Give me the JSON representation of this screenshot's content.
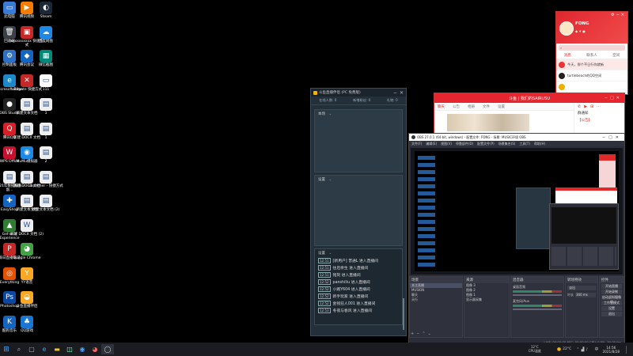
{
  "desktop": {
    "icons_col1": [
      {
        "label": "此电脑",
        "color": "#3a7bd5",
        "glyph": "▭"
      },
      {
        "label": "回收站",
        "color": "#3b3f47",
        "glyph": "🗑"
      },
      {
        "label": "控制面板",
        "color": "#2f6fc4",
        "glyph": "⚙"
      },
      {
        "label": "Microsoft Edge",
        "color": "#1e88c8",
        "glyph": "e"
      },
      {
        "label": "OBS Studio",
        "color": "#222",
        "glyph": "●"
      },
      {
        "label": "腾讯QQ",
        "color": "#d61f26",
        "glyph": "Q"
      },
      {
        "label": "WPS Office",
        "color": "#c8102e",
        "glyph": "W"
      },
      {
        "label": "2021年数据报表 - 副...",
        "color": "#eee",
        "glyph": "▤"
      },
      {
        "label": "EasyShop",
        "color": "#1565c0",
        "glyph": "✚"
      },
      {
        "label": "GeForce Experience",
        "color": "#2e7d32",
        "glyph": "▲"
      },
      {
        "label": "每日直播笔记",
        "color": "#c62828",
        "glyph": "P"
      },
      {
        "label": "Everything",
        "color": "#e65100",
        "glyph": "◎"
      },
      {
        "label": "Photoshop",
        "color": "#0d47a1",
        "glyph": "Ps"
      },
      {
        "label": "酷狗音乐",
        "color": "#1565c0",
        "glyph": "K"
      }
    ],
    "icons_col2": [
      {
        "label": "腾讯视频",
        "color": "#f57c00",
        "glyph": "▶"
      },
      {
        "label": "xxxxxxxxxx 快速方式",
        "color": "#c62828",
        "glyph": "▣"
      },
      {
        "label": "腾讯会议",
        "color": "#1565c0",
        "glyph": "◆"
      },
      {
        "label": "ultimate 快捷方式",
        "color": "#c62828",
        "glyph": "✕"
      },
      {
        "label": "新建文本文档",
        "color": "#eee",
        "glyph": "▤"
      },
      {
        "label": "新建 DOCX 文档",
        "color": "#eee",
        "glyph": "▤"
      },
      {
        "label": "MuMu模拟器",
        "color": "#1e88e5",
        "glyph": "◉"
      },
      {
        "label": "新建 DOCX 文档",
        "color": "#eee",
        "glyph": "▤"
      },
      {
        "label": "新建文本文档",
        "color": "#eee",
        "glyph": "▤"
      },
      {
        "label": "新建 DOCX 文档 (2)",
        "color": "#eee",
        "glyph": "W"
      },
      {
        "label": "Google Chrome",
        "color": "#43a047",
        "glyph": "◕"
      },
      {
        "label": "YY语音",
        "color": "#f9a825",
        "glyph": "Y"
      },
      {
        "label": "斗鱼直播伴侣",
        "color": "#f9a825",
        "glyph": "◒"
      },
      {
        "label": "QQ游戏",
        "color": "#1976d2",
        "glyph": "♣"
      }
    ],
    "icons_col3": [
      {
        "label": "Steam",
        "color": "#1b2838",
        "glyph": "◐"
      },
      {
        "label": "百度网盘",
        "color": "#1e88e5",
        "glyph": "☁"
      },
      {
        "label": "微信截图",
        "color": "#00897b",
        "glyph": "▦"
      },
      {
        "label": "111",
        "color": "#fff",
        "glyph": "▭"
      },
      {
        "label": "1",
        "color": "#eee",
        "glyph": "▤"
      },
      {
        "label": "1",
        "color": "#eee",
        "glyph": "▤"
      },
      {
        "label": "2",
        "color": "#eee",
        "glyph": "▤"
      },
      {
        "label": "Launcher - 快捷方式",
        "color": "#eee",
        "glyph": "▤"
      },
      {
        "label": "新建文本文档 (2)",
        "color": "#eee",
        "glyph": "▤"
      }
    ]
  },
  "danmu": {
    "title": "斗鱼直播伴侣 (PC 免费版)",
    "stats": [
      "在线人数: 0",
      "新增粉丝: 0",
      "礼物: 0"
    ],
    "panel1_label": "本场",
    "panel2_label": "设置",
    "panel3_label": "设置",
    "messages": [
      {
        "time": "12:51",
        "text": "[新用户] 普通L 进入直播间"
      },
      {
        "time": "12:51",
        "text": "往后余生 进入直播间"
      },
      {
        "time": "12:51",
        "text": "铭刻 进入直播间"
      },
      {
        "time": "12:52",
        "text": "panshiliu 进入直播间"
      },
      {
        "time": "12:52",
        "text": "小路Y604 进入直播间"
      },
      {
        "time": "12:52",
        "text": "新手玩家 进入直播间"
      },
      {
        "time": "12:52",
        "text": "金钱狂人001 进入直播间"
      },
      {
        "time": "12:53",
        "text": "冬夜与春风 进入直播间"
      }
    ]
  },
  "qq": {
    "name": "FONG",
    "tabs": [
      "消息",
      "联系人",
      "空间"
    ],
    "chats": [
      {
        "name": "今天，那个不日行你就新",
        "preview": ""
      },
      {
        "name": "turtlebeach的QQ空间",
        "preview": ""
      },
      {
        "name": "",
        "preview": ""
      }
    ]
  },
  "chat_window": {
    "title": "斗鱼 | 我们的SAIRUSU",
    "tabs": [
      "聊天",
      "公告",
      "相册",
      "文件",
      "设置"
    ],
    "side_name": "群通知",
    "side_msg": "【公告】"
  },
  "obs": {
    "title": "OBS 27.0.1 (64-bit, windows) - 配置文件: FONG - 场景: MUSIC环境 OBS",
    "menu": [
      "文件(F)",
      "编辑(E)",
      "视图(V)",
      "停靠部件(D)",
      "配置文件(P)",
      "场景集合(S)",
      "工具(T)",
      "帮助(H)"
    ],
    "scenes_header": "场景",
    "scenes": [
      "关注直播",
      "MUSION",
      "聊天",
      "天行"
    ],
    "sources_header": "来源",
    "sources": [
      "图像 3",
      "图像 2",
      "图像 1",
      "显示器采集"
    ],
    "mixer_header": "混音器",
    "mixer": [
      "桌面音频",
      "麦克风/Aux"
    ],
    "transitions_header": "转场特效",
    "transition_value": "淡出",
    "duration_label": "时长",
    "duration_value": "300 ms",
    "controls_header": "控件",
    "controls": [
      "开始直播",
      "开始录制",
      "启动虚拟摄像机",
      "工作室模式",
      "设置",
      "退出"
    ],
    "status": "LIVE: 00:00:00   REC: 00:00:00   CPU: 0.5%, 30.00 fps"
  },
  "taskbar": {
    "weather": "12°C",
    "weather_desc": "CPU温度",
    "temp": "22°C",
    "time": "14:56",
    "date": "2021/8/28",
    "lang": "中"
  }
}
